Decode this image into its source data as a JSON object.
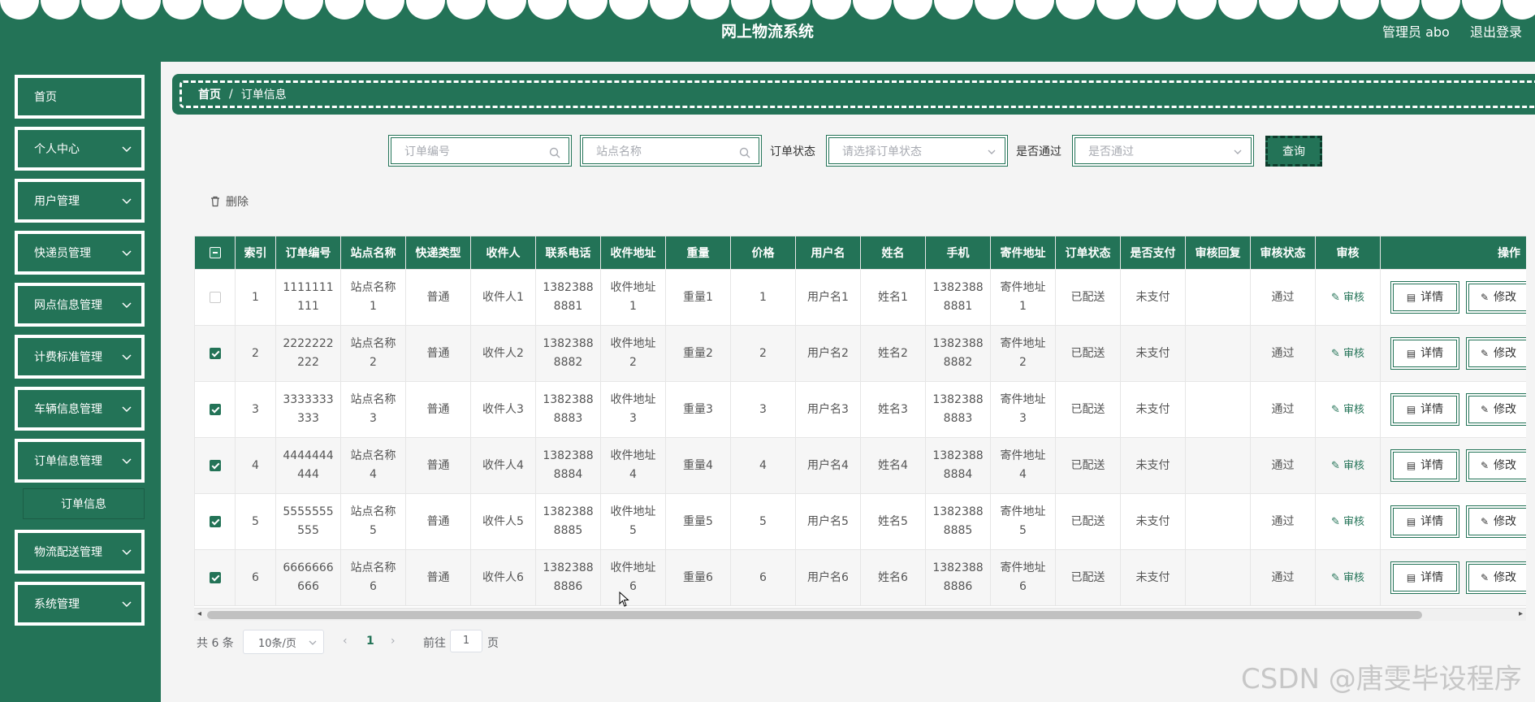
{
  "header": {
    "title": "网上物流系统",
    "user": "管理员 abo",
    "logout": "退出登录"
  },
  "sidebar": {
    "items": [
      {
        "label": "首页",
        "chevron": false
      },
      {
        "label": "个人中心",
        "chevron": true
      },
      {
        "label": "用户管理",
        "chevron": true
      },
      {
        "label": "快递员管理",
        "chevron": true
      },
      {
        "label": "网点信息管理",
        "chevron": true
      },
      {
        "label": "计费标准管理",
        "chevron": true
      },
      {
        "label": "车辆信息管理",
        "chevron": true
      },
      {
        "label": "订单信息管理",
        "chevron": true
      },
      {
        "label": "物流配送管理",
        "chevron": true
      },
      {
        "label": "系统管理",
        "chevron": true
      }
    ],
    "sub_item": "订单信息"
  },
  "breadcrumb": {
    "home": "首页",
    "sep": "/",
    "current": "订单信息"
  },
  "search": {
    "order_no_placeholder": "订单编号",
    "site_placeholder": "站点名称",
    "status_label": "订单状态",
    "status_placeholder": "请选择订单状态",
    "pass_label": "是否通过",
    "pass_placeholder": "是否通过",
    "query_button": "查询"
  },
  "toolbar": {
    "delete_label": "删除"
  },
  "table": {
    "headers": [
      "索引",
      "订单编号",
      "站点名称",
      "快递类型",
      "收件人",
      "联系电话",
      "收件地址",
      "重量",
      "价格",
      "用户名",
      "姓名",
      "手机",
      "寄件地址",
      "订单状态",
      "是否支付",
      "审核回复",
      "审核状态",
      "审核",
      "操作"
    ],
    "rows": [
      {
        "checked": false,
        "cells": [
          "1",
          "1111111111",
          "站点名称1",
          "普通",
          "收件人1",
          "13823888881",
          "收件地址1",
          "重量1",
          "1",
          "用户名1",
          "姓名1",
          "13823888881",
          "寄件地址1",
          "已配送",
          "未支付",
          "",
          "通过"
        ]
      },
      {
        "checked": true,
        "cells": [
          "2",
          "2222222222",
          "站点名称2",
          "普通",
          "收件人2",
          "13823888882",
          "收件地址2",
          "重量2",
          "2",
          "用户名2",
          "姓名2",
          "13823888882",
          "寄件地址2",
          "已配送",
          "未支付",
          "",
          "通过"
        ]
      },
      {
        "checked": true,
        "cells": [
          "3",
          "3333333333",
          "站点名称3",
          "普通",
          "收件人3",
          "13823888883",
          "收件地址3",
          "重量3",
          "3",
          "用户名3",
          "姓名3",
          "13823888883",
          "寄件地址3",
          "已配送",
          "未支付",
          "",
          "通过"
        ]
      },
      {
        "checked": true,
        "cells": [
          "4",
          "4444444444",
          "站点名称4",
          "普通",
          "收件人4",
          "13823888884",
          "收件地址4",
          "重量4",
          "4",
          "用户名4",
          "姓名4",
          "13823888884",
          "寄件地址4",
          "已配送",
          "未支付",
          "",
          "通过"
        ]
      },
      {
        "checked": true,
        "cells": [
          "5",
          "5555555555",
          "站点名称5",
          "普通",
          "收件人5",
          "13823888885",
          "收件地址5",
          "重量5",
          "5",
          "用户名5",
          "姓名5",
          "13823888885",
          "寄件地址5",
          "已配送",
          "未支付",
          "",
          "通过"
        ]
      },
      {
        "checked": true,
        "cells": [
          "6",
          "6666666666",
          "站点名称6",
          "普通",
          "收件人6",
          "13823888886",
          "收件地址6",
          "重量6",
          "6",
          "用户名6",
          "姓名6",
          "13823888886",
          "寄件地址6",
          "已配送",
          "未支付",
          "",
          "通过"
        ]
      }
    ],
    "audit_link": "审核",
    "detail_button": "详情",
    "edit_button": "修改"
  },
  "pagination": {
    "total": "共 6 条",
    "page_size": "10条/页",
    "current_page": "1",
    "goto_label": "前往",
    "goto_value": "1",
    "page_unit": "页"
  },
  "watermark": "CSDN @唐雯毕设程序",
  "colors": {
    "primary": "#237357",
    "header_bg": "#237357",
    "page_bg": "#f4f4f4"
  }
}
